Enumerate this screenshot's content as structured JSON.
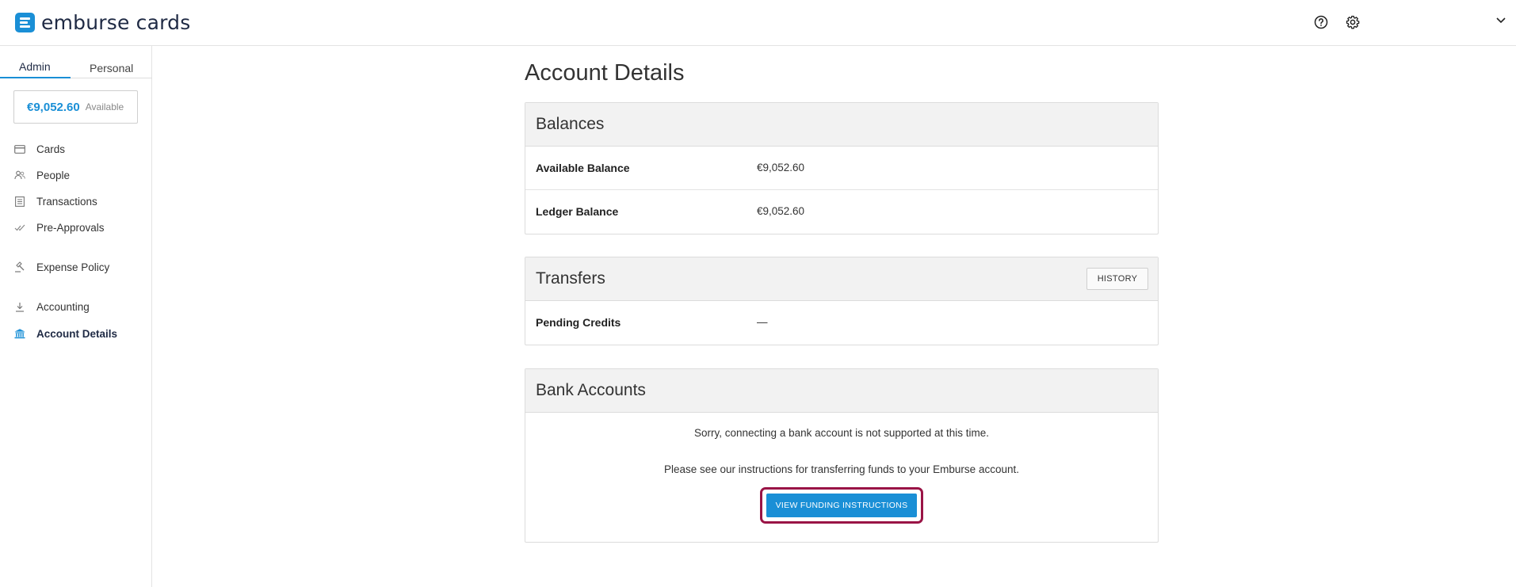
{
  "app": {
    "brand": "emburse cards"
  },
  "sidebar": {
    "tabs": [
      {
        "label": "Admin"
      },
      {
        "label": "Personal"
      }
    ],
    "balance": {
      "amount": "€9,052.60",
      "label": "Available"
    },
    "items": [
      {
        "label": "Cards",
        "icon": "card-icon"
      },
      {
        "label": "People",
        "icon": "people-icon"
      },
      {
        "label": "Transactions",
        "icon": "list-icon"
      },
      {
        "label": "Pre-Approvals",
        "icon": "check-icon"
      },
      {
        "label": "Expense Policy",
        "icon": "gavel-icon"
      },
      {
        "label": "Accounting",
        "icon": "download-icon"
      },
      {
        "label": "Account Details",
        "icon": "bank-icon",
        "active": true
      }
    ]
  },
  "main": {
    "title": "Account Details",
    "balances": {
      "title": "Balances",
      "rows": [
        {
          "label": "Available Balance",
          "value": "€9,052.60"
        },
        {
          "label": "Ledger Balance",
          "value": "€9,052.60"
        }
      ]
    },
    "transfers": {
      "title": "Transfers",
      "history_label": "HISTORY",
      "rows": [
        {
          "label": "Pending Credits",
          "value": "—"
        }
      ]
    },
    "bank_accounts": {
      "title": "Bank Accounts",
      "message1": "Sorry, connecting a bank account is not supported at this time.",
      "message2": "Please see our instructions for transferring funds to your Emburse account.",
      "button_label": "VIEW FUNDING INSTRUCTIONS"
    }
  },
  "colors": {
    "accent": "#1a8fd6",
    "highlight": "#9a1446"
  }
}
